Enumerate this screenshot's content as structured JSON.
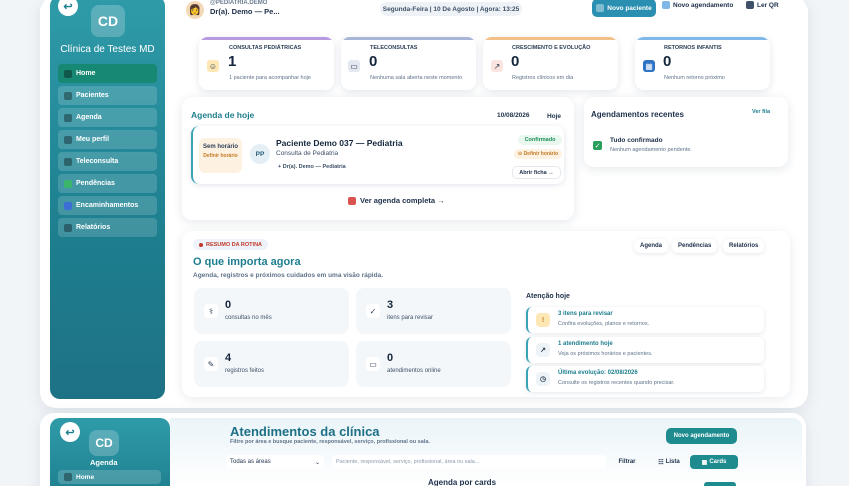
{
  "app": {
    "initials": "CD",
    "clinic_name": "Clínica de Testes MD",
    "logo_glyph": "↩"
  },
  "sidebar": {
    "items": [
      {
        "label": "Home",
        "icon": "home-icon",
        "active": true
      },
      {
        "label": "Pacientes",
        "icon": "patients-icon"
      },
      {
        "label": "Agenda",
        "icon": "calendar-icon"
      },
      {
        "label": "Meu perfil",
        "icon": "user-icon"
      },
      {
        "label": "Teleconsulta",
        "icon": "video-icon"
      },
      {
        "label": "Pendências",
        "icon": "check-icon"
      },
      {
        "label": "Encaminhamentos",
        "icon": "referral-icon"
      },
      {
        "label": "Relatórios",
        "icon": "report-icon"
      }
    ]
  },
  "topbar": {
    "handle": "@PEDIATRIA.DEMO",
    "user_name": "Dr(a). Demo — Pe...",
    "date_text": "Segunda-Feira | 10 De Agosto | Agora: 13:25",
    "new_patient_label": "Novo paciente",
    "new_appointment_label": "Novo agendamento",
    "qr_label": "Ler QR"
  },
  "stats": [
    {
      "title": "CONSULTAS PEDIÁTRICAS",
      "value": "1",
      "desc": "1 paciente para acompanhar hoje",
      "color": "#b79ae0",
      "icon": "pediatric-icon"
    },
    {
      "title": "TELECONSULTAS",
      "value": "0",
      "desc": "Nenhuma sala aberta neste momento",
      "color": "#a7b6d6",
      "icon": "laptop-icon"
    },
    {
      "title": "CRESCIMENTO E EVOLUÇÃO",
      "value": "0",
      "desc": "Registros clínicos em dia",
      "color": "#f2c087",
      "icon": "growth-icon"
    },
    {
      "title": "RETORNOS INFANTIS",
      "value": "0",
      "desc": "Nenhum retorno próximo",
      "color": "#7fb8e8",
      "icon": "calendar-icon"
    }
  ],
  "agenda": {
    "title": "Agenda de hoje",
    "date": "10/08/2026",
    "today_label": "Hoje",
    "appointment": {
      "time_label": "Sem horário",
      "time_define": "Definir horário",
      "initials": "PP",
      "patient": "Paciente Demo 037 — Pediatria",
      "type": "Consulta de Pediatria",
      "doctor": "+ Dr(a). Demo — Pediatria",
      "status": "Confirmado",
      "define_badge": "⊙ Definir horário",
      "open_label": "Abrir ficha →"
    },
    "full_link": "Ver agenda completa →"
  },
  "recent": {
    "title": "Agendamentos recentes",
    "queue_label": "Ver fila",
    "main": "Tudo confirmado",
    "sub": "Nenhum agendamento pendente."
  },
  "routine": {
    "tag": "RESUMO DA ROTINA",
    "title": "O que importa agora",
    "subtitle": "Agenda, registros e próximos cuidados em uma visão rápida.",
    "tabs": [
      "Agenda",
      "Pendências",
      "Relatórios"
    ],
    "metrics": [
      {
        "value": "0",
        "label": "consultas no mês",
        "icon": "stethoscope-icon"
      },
      {
        "value": "3",
        "label": "itens para revisar",
        "icon": "check-icon"
      },
      {
        "value": "4",
        "label": "registros feitos",
        "icon": "notes-icon"
      },
      {
        "value": "0",
        "label": "atendimentos online",
        "icon": "laptop-icon"
      }
    ],
    "attention_title": "Atenção hoje",
    "attention": [
      {
        "main": "3 itens para revisar",
        "sub": "Confira evoluções, planos e retornos.",
        "icon": "alert-icon",
        "glyph": "!"
      },
      {
        "main": "1 atendimento hoje",
        "sub": "Veja os próximos horários e pacientes.",
        "icon": "arrow-icon",
        "glyph": "↗"
      },
      {
        "main": "Última evolução: 02/08/2026",
        "sub": "Consulte os registros recentes quando precisar.",
        "icon": "clock-icon",
        "glyph": "◷"
      }
    ]
  },
  "second": {
    "initials": "CD",
    "section": "Agenda",
    "home_label": "Home",
    "title": "Atendimentos da clínica",
    "subtitle": "Filtre por área e busque paciente, responsável, serviço, profissional ou sala.",
    "new_appointment_label": "Novo agendamento",
    "area_select": "Todas as áreas",
    "search_placeholder": "Paciente, responsável, serviço, profissional, área ou sala...",
    "filter_label": "Filtrar",
    "list_label": "Lista",
    "cards_label": "Cards",
    "cards_title": "Agenda por cards"
  }
}
